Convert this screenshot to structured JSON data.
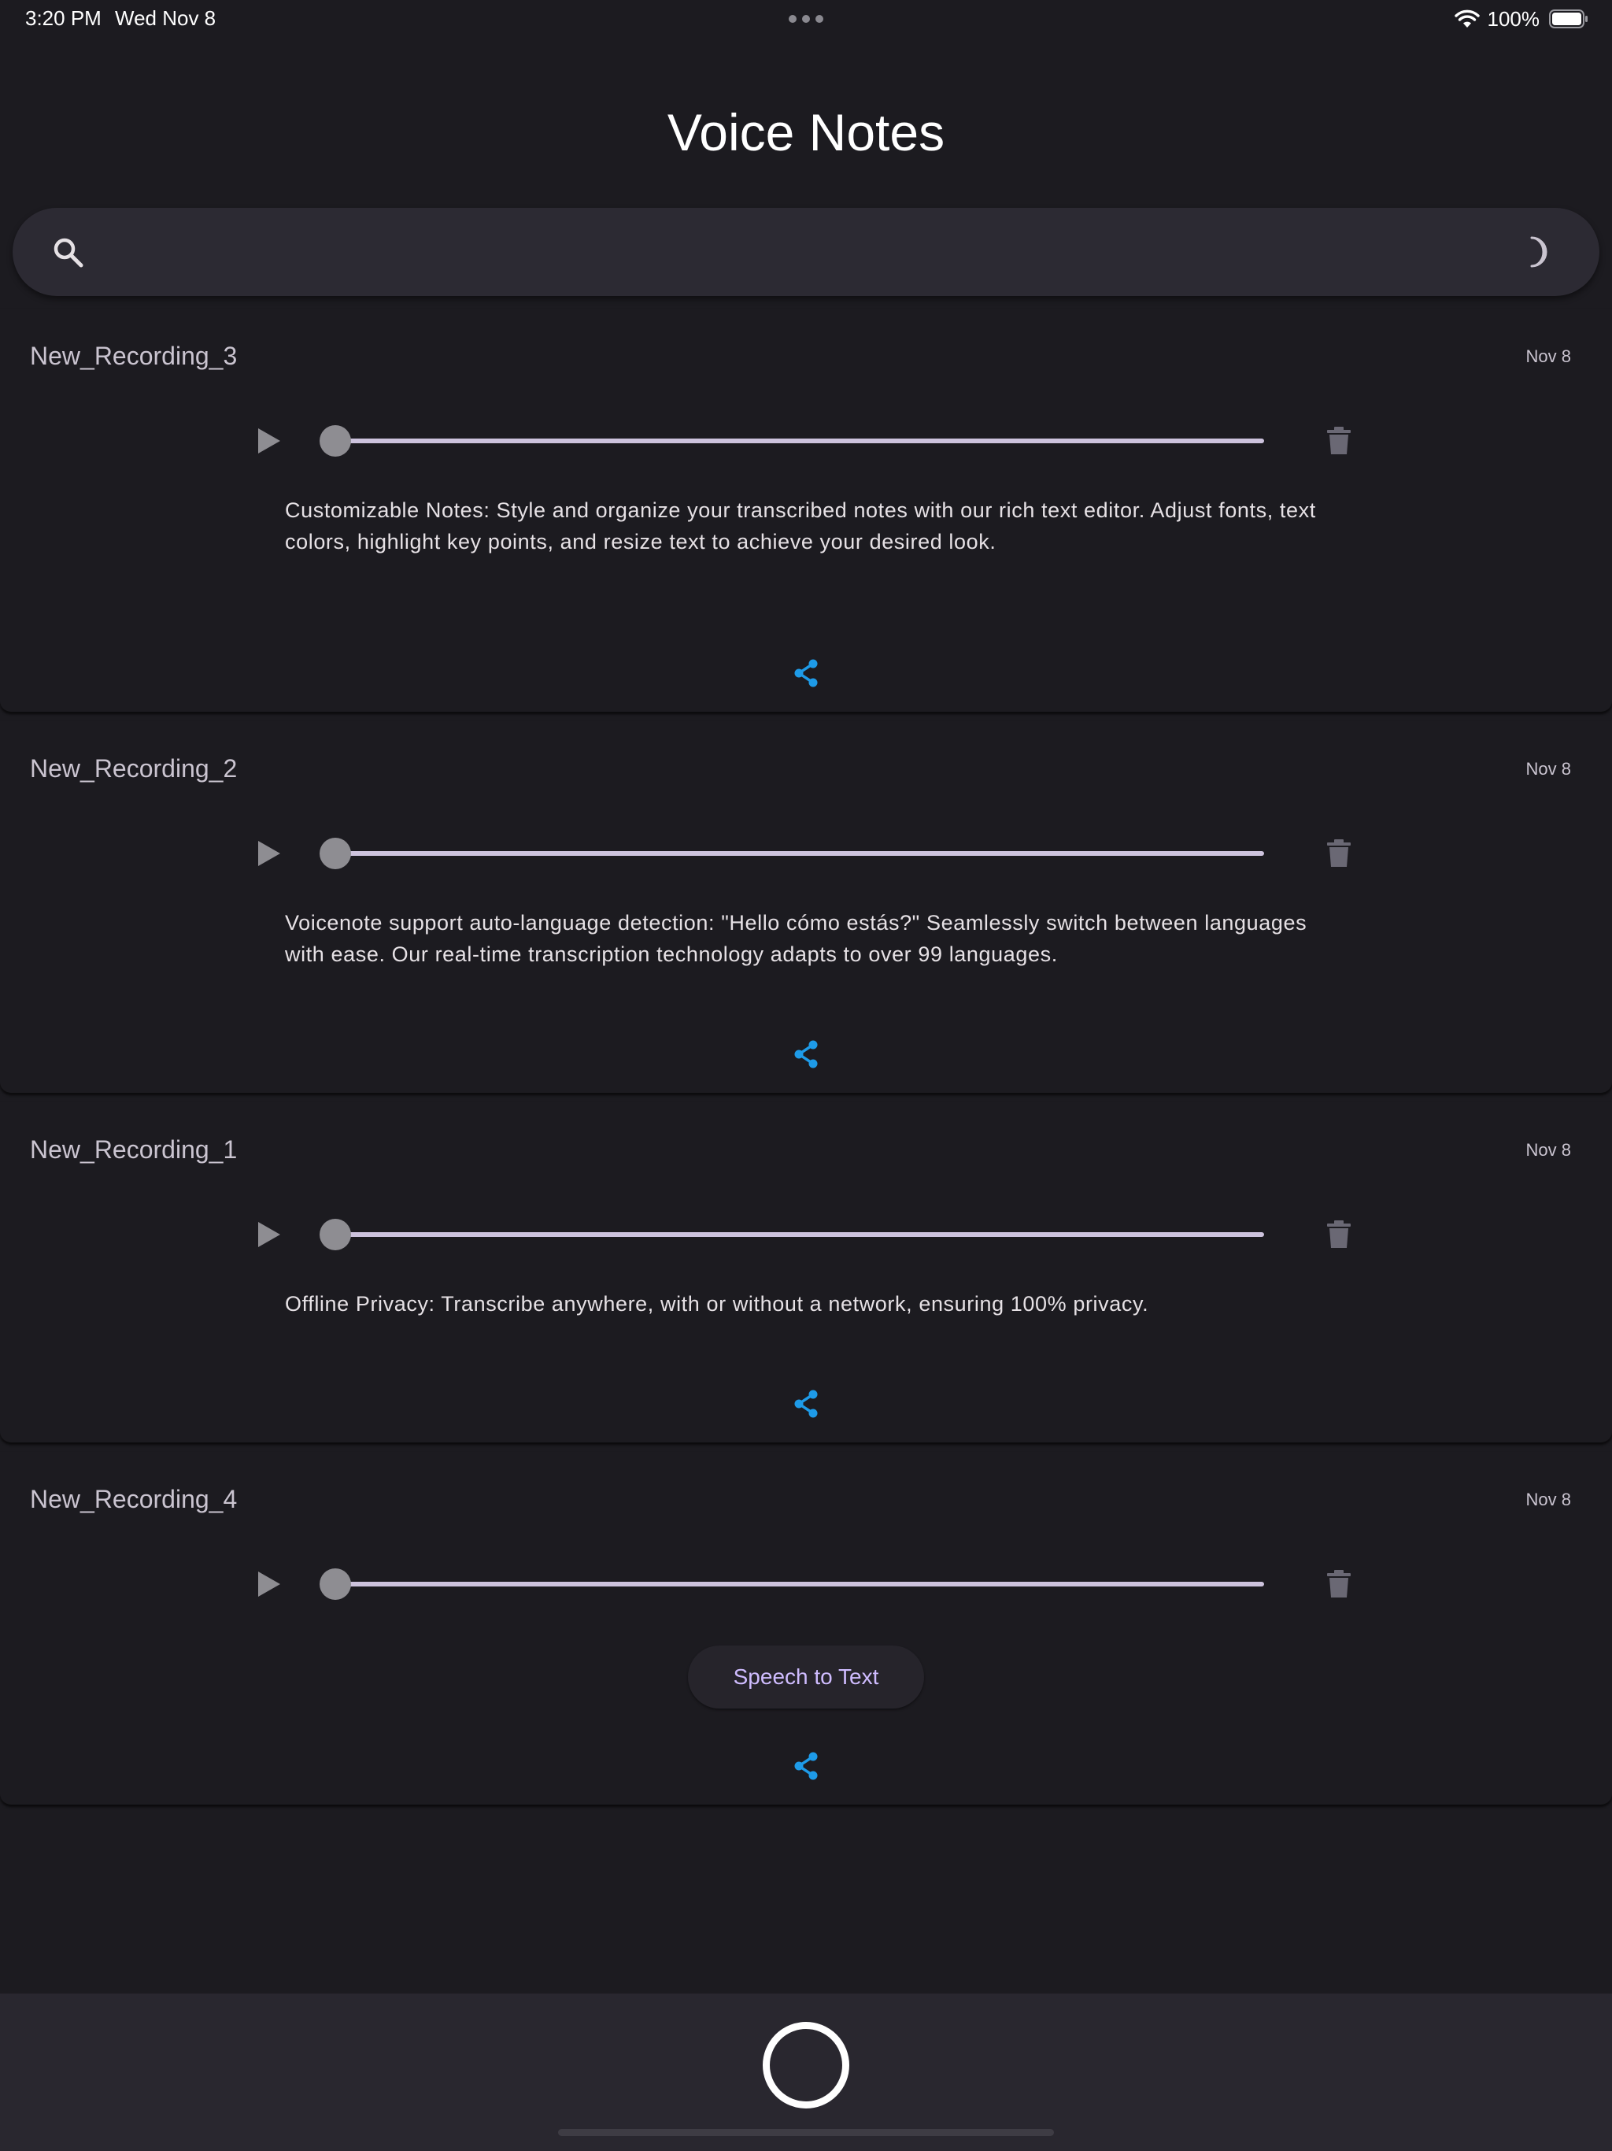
{
  "status_bar": {
    "time": "3:20 PM",
    "date": "Wed Nov 8",
    "battery": "100%"
  },
  "page_title": "Voice Notes",
  "search": {
    "placeholder": "",
    "value": ""
  },
  "recordings": [
    {
      "title": "New_Recording_3",
      "date": "Nov 8",
      "progress": 0,
      "transcript": "Customizable Notes: Style and organize your transcribed notes with our rich text editor. Adjust fonts, text colors, highlight key points, and resize text to achieve your desired look."
    },
    {
      "title": "New_Recording_2",
      "date": "Nov 8",
      "progress": 0,
      "transcript": "Voicenote support  auto-language detection: \"Hello cómo estás?\" Seamlessly switch between languages with ease. Our real-time transcription technology adapts to over 99 languages."
    },
    {
      "title": "New_Recording_1",
      "date": "Nov 8",
      "progress": 0,
      "transcript": "Offline Privacy: Transcribe anywhere, with or without a network, ensuring 100% privacy."
    },
    {
      "title": "New_Recording_4",
      "date": "Nov 8",
      "progress": 0,
      "speech_to_text_label": "Speech to Text"
    }
  ],
  "icons": {
    "search": "search-icon",
    "theme_toggle": "moon-icon",
    "play": "play-icon",
    "delete": "trash-icon",
    "share": "share-icon",
    "record": "record-icon"
  },
  "colors": {
    "background": "#1c1b20",
    "surface": "#2c2a33",
    "share_accent": "#1e9be8",
    "button_text": "#cfbcff",
    "slider_track": "#cdc3dd"
  }
}
